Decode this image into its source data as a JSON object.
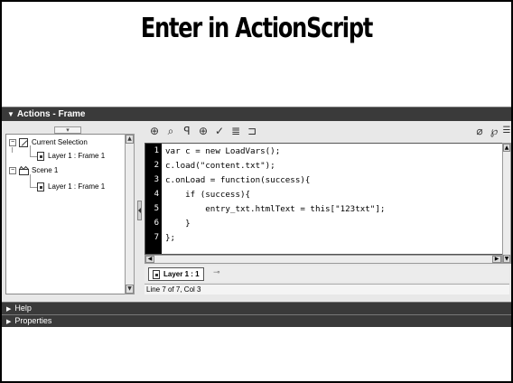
{
  "slide": {
    "title": "Enter in ActionScript"
  },
  "panel": {
    "title": "Actions - Frame",
    "tree": {
      "current_selection": "Current Selection",
      "current_frame": "Layer 1 : Frame 1",
      "scene": "Scene 1",
      "scene_frame": "Layer 1 : Frame 1"
    },
    "toolbar": {
      "icons": [
        "add-icon",
        "find-icon",
        "replace-icon",
        "target-icon",
        "check-syntax-icon",
        "auto-format-icon",
        "code-hint-icon",
        "debug-icon",
        "reference-icon",
        "menu-icon"
      ]
    },
    "code": {
      "lines": [
        {
          "num": "1",
          "text": "var c = new LoadVars();"
        },
        {
          "num": "2",
          "text": "c.load(\"content.txt\");"
        },
        {
          "num": "3",
          "text": "c.onLoad = function(success){"
        },
        {
          "num": "4",
          "text": "    if (success){"
        },
        {
          "num": "5",
          "text": "        entry_txt.htmlText = this[\"123txt\"];"
        },
        {
          "num": "6",
          "text": "    }"
        },
        {
          "num": "7",
          "text": "};"
        }
      ]
    },
    "tab_label": "Layer 1 : 1",
    "status": "Line 7 of 7, Col 3"
  },
  "help_panel": {
    "label": "Help"
  },
  "properties_panel": {
    "label": "Properties"
  }
}
